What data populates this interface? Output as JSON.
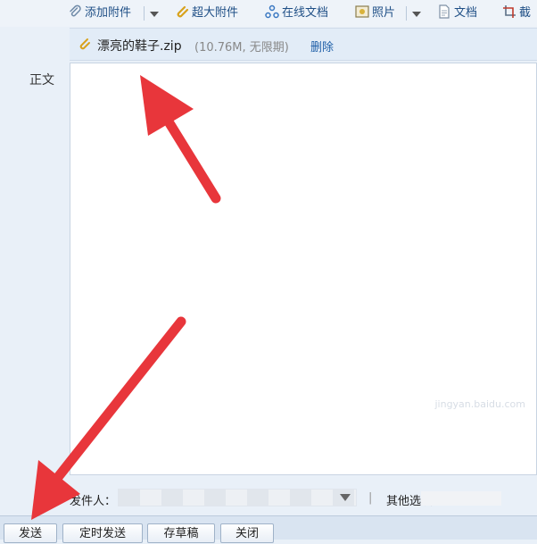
{
  "toolbar": {
    "add_attachment": "添加附件",
    "large_attachment": "超大附件",
    "online_doc": "在线文档",
    "photo": "照片",
    "document": "文档",
    "screenshot": "截",
    "icons": [
      "paperclip-icon",
      "large-attachment-icon",
      "online-doc-icon",
      "photo-icon",
      "document-icon",
      "screenshot-icon"
    ]
  },
  "attachment": {
    "filename": "漂亮的鞋子.zip",
    "meta": "(10.76M, 无限期)",
    "delete": "删除"
  },
  "body_label": "正文",
  "watermark": "jingyan.baidu.com",
  "sender": {
    "label": "发件人：",
    "separator": "|",
    "other_options": "其他选项"
  },
  "buttons": {
    "send": "发送",
    "scheduled_send": "定时发送",
    "save_draft": "存草稿",
    "close": "关闭"
  },
  "colors": {
    "link": "#1f4f86",
    "arrow": "#e8363b",
    "toolbar_bg": "#eef3f9",
    "bar_bg": "#d9e4f1"
  }
}
